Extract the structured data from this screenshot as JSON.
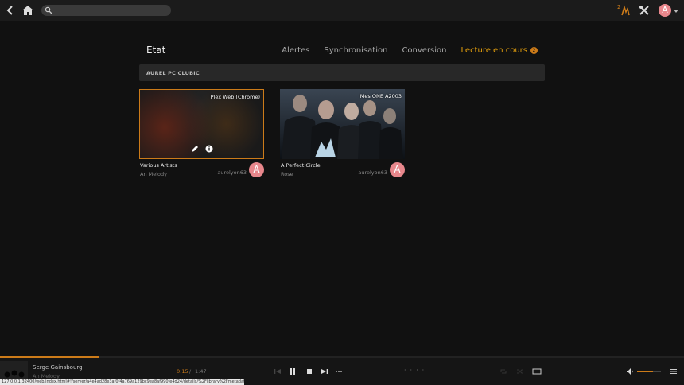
{
  "topbar": {
    "search_placeholder": "",
    "activity_count": "2"
  },
  "header": {
    "title": "Etat",
    "tabs": [
      {
        "label": "Alertes"
      },
      {
        "label": "Synchronisation"
      },
      {
        "label": "Conversion"
      },
      {
        "label": "Lecture en cours",
        "badge": "2"
      }
    ]
  },
  "section": {
    "label": "AUREL PC CLUBIC"
  },
  "sessions": [
    {
      "player": "Plex Web (Chrome)",
      "title": "Various Artists",
      "subtitle": "An Melody",
      "user": "aurelyon63",
      "avatar": "A"
    },
    {
      "player": "Mes ONE A2003",
      "title": "A Perfect Circle",
      "subtitle": "Rose",
      "user": "aurelyon63",
      "avatar": "A"
    }
  ],
  "user_avatar": "A",
  "player": {
    "track": "Serge Gainsbourg",
    "track_sub": "An Melody",
    "time_current": "0:15",
    "time_separator": "/",
    "time_total": "1:47",
    "progress": 0.144,
    "volume": 0.67
  },
  "status_url": "127.0.0.1:32400/web/index.html#!/server/a4e4ad28e3af0f4a769a129bc9ea8af990fe4d24/details/%2Flibrary%2Fmetadata%2F1845",
  "colors": {
    "accent": "#cc7b19",
    "avatar": "#e8878c"
  }
}
